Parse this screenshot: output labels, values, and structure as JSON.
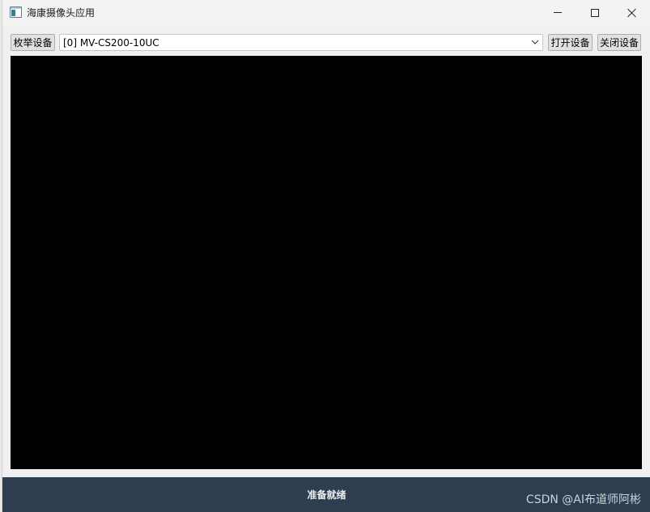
{
  "window": {
    "title": "海康摄像头应用",
    "controls": {
      "minimize": "minimize-icon",
      "maximize": "maximize-icon",
      "close": "close-icon"
    }
  },
  "toolbar": {
    "enumerate_label": "枚举设备",
    "device_selected": "[0] MV-CS200-10UC",
    "open_label": "打开设备",
    "close_label": "关闭设备"
  },
  "video": {
    "background": "#000000"
  },
  "status": {
    "text": "准备就绪",
    "bar_color": "#2c3e50"
  },
  "watermark": "CSDN @AI布道师阿彬"
}
